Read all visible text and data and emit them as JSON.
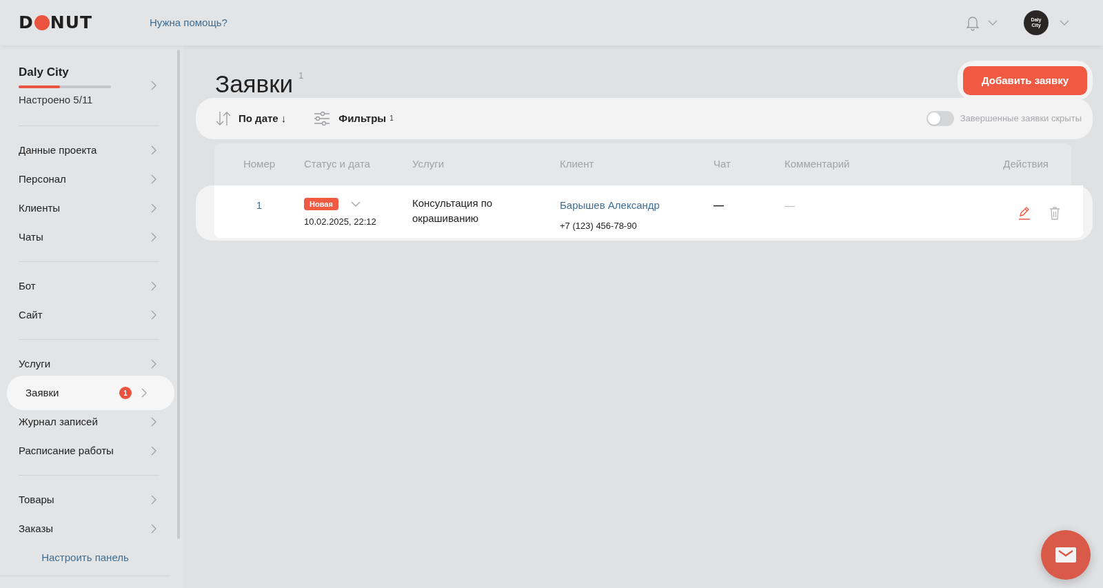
{
  "header": {
    "logo": {
      "before": "D",
      "after": "NUT"
    },
    "help_link": "Нужна помощь?",
    "avatar_text": "Daly City"
  },
  "project": {
    "name": "Daly City",
    "progress_label": "Настроено 5/11",
    "level": 0.45
  },
  "sidebar": {
    "groups": [
      [
        {
          "label": "Данные проекта",
          "selected": false
        },
        {
          "label": "Персонал",
          "selected": false
        },
        {
          "label": "Клиенты",
          "selected": false
        },
        {
          "label": "Чаты",
          "selected": false
        }
      ],
      [
        {
          "label": "Бот",
          "selected": false
        },
        {
          "label": "Сайт",
          "selected": false
        }
      ],
      [
        {
          "label": "Услуги",
          "selected": false
        },
        {
          "label": "Заявки",
          "selected": true,
          "badge": "1"
        },
        {
          "label": "Журнал записей",
          "selected": false
        },
        {
          "label": "Расписание работы",
          "selected": false
        }
      ],
      [
        {
          "label": "Товары",
          "selected": false
        },
        {
          "label": "Заказы",
          "selected": false
        }
      ]
    ],
    "customize_link": "Настроить панель"
  },
  "page": {
    "title": "Заявки",
    "count": "1",
    "add_button": "Добавить заявку"
  },
  "toolbar": {
    "sort": "По дате ↓",
    "filters": "Фильтры",
    "filters_count": "1",
    "toggle": {
      "on": false,
      "label": "Завершенные заявки скрыты"
    }
  },
  "table": {
    "columns": [
      "Номер",
      "Статус и дата",
      "Услуги",
      "Клиент",
      "Чат",
      "Комментарий",
      "Действия"
    ],
    "rows": [
      {
        "number": "1",
        "status": "Новая",
        "date": "10.02.2025, 22:12",
        "service": "Консультация по окрашиванию",
        "client": "Барышев Александр",
        "phone": "+7 (123) 456-78-90",
        "chat": "—",
        "comment": "—"
      }
    ]
  }
}
